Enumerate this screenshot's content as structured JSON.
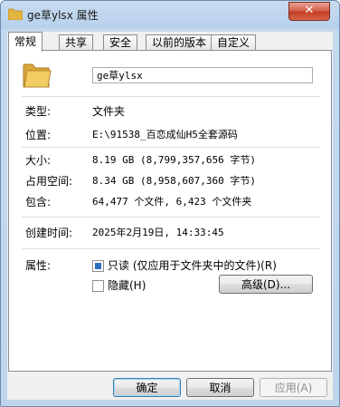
{
  "window": {
    "title": "ge草ylsx 属性",
    "close_label": "✕"
  },
  "tabs": [
    {
      "label": "常规",
      "active": true
    },
    {
      "label": "共享"
    },
    {
      "label": "安全"
    },
    {
      "label": "以前的版本"
    },
    {
      "label": "自定义"
    }
  ],
  "general": {
    "name": "ge草ylsx",
    "rows": [
      {
        "label": "类型:",
        "value": "文件夹"
      },
      {
        "label": "位置:",
        "value": "E:\\91538_百恋成仙H5全套源码"
      },
      {
        "label": "大小:",
        "value": "8.19 GB (8,799,357,656 字节)"
      },
      {
        "label": "占用空间:",
        "value": "8.34 GB (8,958,607,360 字节)"
      },
      {
        "label": "包含:",
        "value": "64,477 个文件, 6,423 个文件夹"
      },
      {
        "label": "创建时间:",
        "value": "2025年2月19日, 14:33:45"
      }
    ],
    "attributes_label": "属性:",
    "readonly_label": "只读 (仅应用于文件夹中的文件)(R)",
    "hidden_label": "隐藏(H)",
    "advanced_label": "高级(D)..."
  },
  "buttons": {
    "ok": "确定",
    "cancel": "取消",
    "apply": "应用(A)"
  },
  "colors": {
    "accent": "#2f6fc1",
    "close": "#c23b22"
  },
  "icons": [
    "folder-icon",
    "close-icon"
  ]
}
